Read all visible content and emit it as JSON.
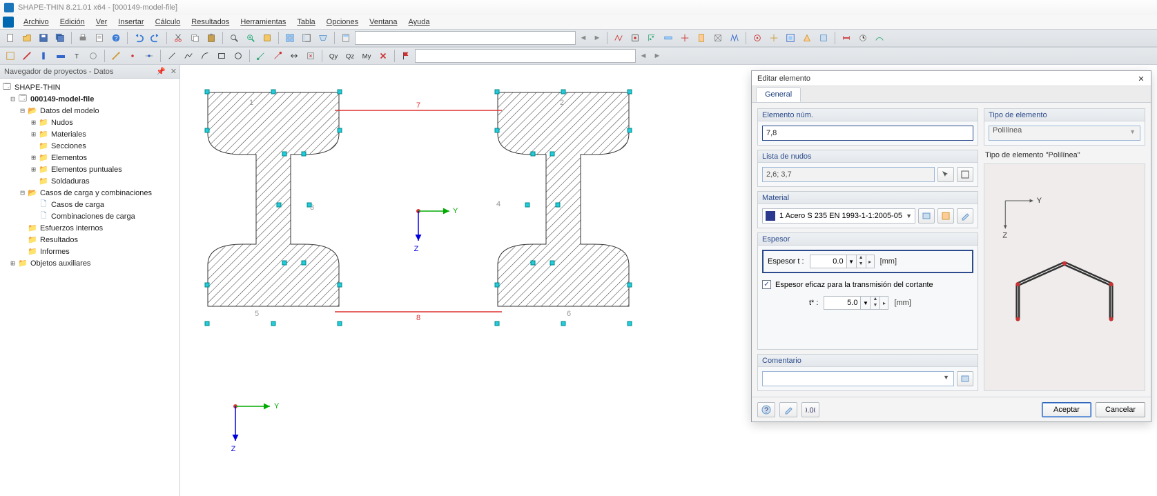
{
  "app": {
    "title": "SHAPE-THIN 8.21.01 x64 - [000149-model-file]"
  },
  "menu": [
    "Archivo",
    "Edición",
    "Ver",
    "Insertar",
    "Cálculo",
    "Resultados",
    "Herramientas",
    "Tabla",
    "Opciones",
    "Ventana",
    "Ayuda"
  ],
  "nav": {
    "title": "Navegador de proyectos - Datos",
    "root": "SHAPE-THIN",
    "project": "000149-model-file",
    "items": [
      "Datos del modelo",
      "Nudos",
      "Materiales",
      "Secciones",
      "Elementos",
      "Elementos puntuales",
      "Soldaduras",
      "Casos de carga y combinaciones",
      "Casos de carga",
      "Combinaciones de carga",
      "Esfuerzos internos",
      "Resultados",
      "Informes",
      "Objetos auxiliares"
    ]
  },
  "dialog": {
    "title": "Editar elemento",
    "tab": "General",
    "elem_num_label": "Elemento núm.",
    "elem_num": "7,8",
    "tipo_label": "Tipo de elemento",
    "tipo_value": "Polilínea",
    "nodes_label": "Lista de nudos",
    "nodes_value": "2,6; 3,7",
    "material_label": "Material",
    "material_value": "1 Acero S 235 EN 1993-1-1:2005-05",
    "espesor_label": "Espesor",
    "espesor_t_label": "Espesor    t :",
    "espesor_t": "0.0",
    "espesor_unit": "[mm]",
    "chk_label": "Espesor eficaz para la transmisión del cortante",
    "tstar_label": "t* :",
    "tstar": "5.0",
    "preview_label": "Tipo de elemento \"Polilínea\"",
    "comment_label": "Comentario",
    "ok": "Aceptar",
    "cancel": "Cancelar"
  },
  "axes": {
    "y": "Y",
    "z": "Z"
  }
}
